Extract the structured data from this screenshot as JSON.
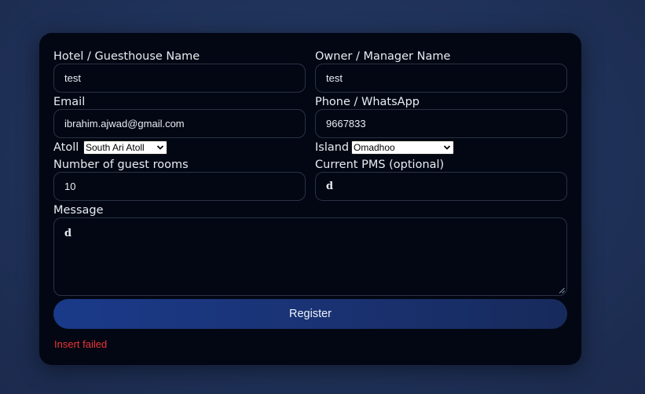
{
  "form": {
    "hotel_name": {
      "label": "Hotel / Guesthouse Name",
      "value": "test"
    },
    "owner_name": {
      "label": "Owner / Manager Name",
      "value": "test"
    },
    "email": {
      "label": "Email",
      "value": "ibrahim.ajwad@gmail.com"
    },
    "phone": {
      "label": "Phone / WhatsApp",
      "value": "9667833"
    },
    "atoll": {
      "label": "Atoll",
      "selected": "South Ari Atoll"
    },
    "island": {
      "label": "Island",
      "selected": "Omadhoo"
    },
    "rooms": {
      "label": "Number of guest rooms",
      "value": "10"
    },
    "pms": {
      "label": "Current PMS (optional)",
      "value": "d"
    },
    "message": {
      "label": "Message",
      "value": "d"
    },
    "submit_label": "Register",
    "error_text": "Insert failed"
  },
  "colors": {
    "background": "#1f3158",
    "card": "#020713",
    "button": "#1a3a8a",
    "error": "#ef3434"
  }
}
